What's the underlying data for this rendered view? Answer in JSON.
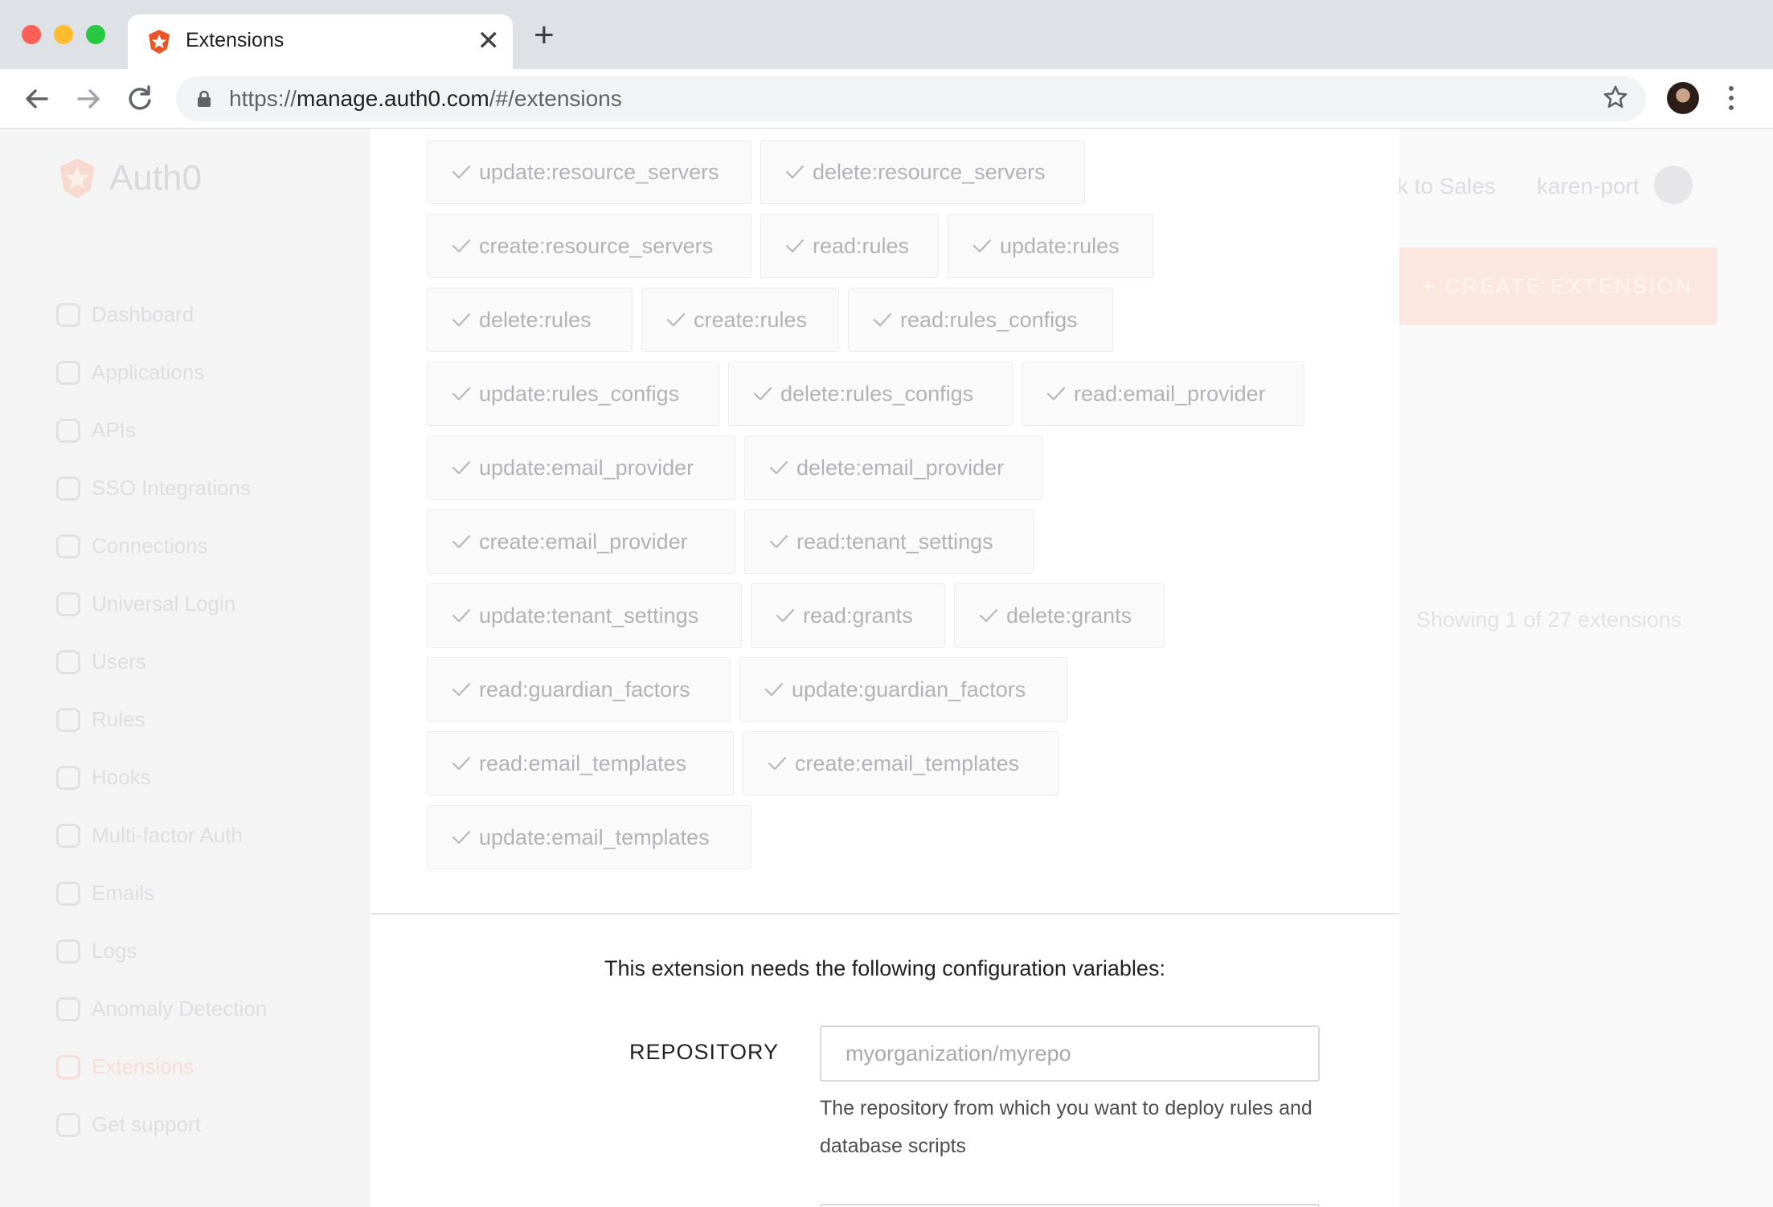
{
  "browser": {
    "tab_title": "Extensions",
    "url_scheme": "https://",
    "url_host": "manage.auth0.com",
    "url_path": "/#/extensions",
    "traffic_lights": [
      "#fe5f57",
      "#febc2e",
      "#28c840"
    ]
  },
  "background_app": {
    "brand": "Auth0",
    "nav": [
      "Dashboard",
      "Applications",
      "APIs",
      "SSO Integrations",
      "Connections",
      "Universal Login",
      "Users",
      "Rules",
      "Hooks",
      "Multi-factor Auth",
      "Emails",
      "Logs",
      "Anomaly Detection",
      "Extensions",
      "Get support"
    ],
    "active_nav": "Extensions",
    "header_link": "k to Sales",
    "username": "karen-port",
    "create_button": "+ CREATE EXTENSION",
    "showing": "Showing 1 of 27 extensions"
  },
  "modal": {
    "scope_rows": [
      [
        "update:resource_servers",
        "delete:resource_servers"
      ],
      [
        "create:resource_servers",
        "read:rules",
        "update:rules"
      ],
      [
        "delete:rules",
        "create:rules",
        "read:rules_configs"
      ],
      [
        "update:rules_configs",
        "delete:rules_configs",
        "read:email_provider"
      ],
      [
        "update:email_provider",
        "delete:email_provider"
      ],
      [
        "create:email_provider",
        "read:tenant_settings"
      ],
      [
        "update:tenant_settings",
        "read:grants",
        "delete:grants"
      ],
      [
        "read:guardian_factors",
        "update:guardian_factors"
      ],
      [
        "read:email_templates",
        "create:email_templates"
      ],
      [
        "update:email_templates"
      ]
    ],
    "config_title": "This extension needs the following configuration variables:",
    "repository": {
      "label": "REPOSITORY",
      "value": "",
      "placeholder": "myorganization/myrepo",
      "help": "The repository from which you want to deploy rules and database scripts"
    }
  },
  "colors": {
    "brand_accent": "#eb5424",
    "overlay_tint": "#f4f4f5"
  }
}
